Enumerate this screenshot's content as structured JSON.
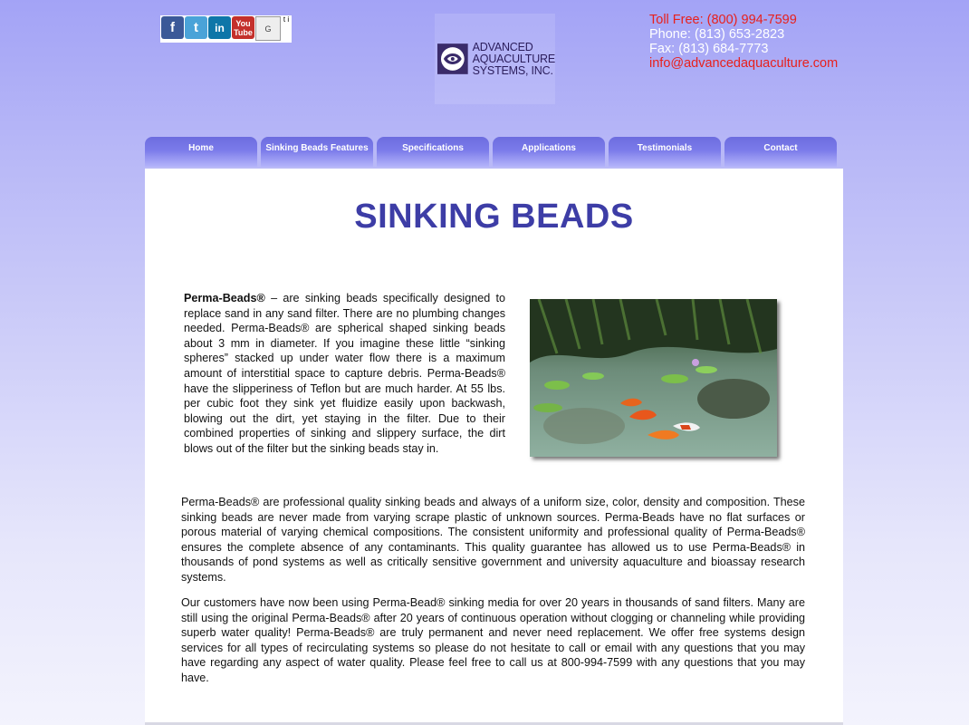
{
  "social": {
    "facebook": "f",
    "twitter": "t",
    "linkedin": "in",
    "youtube_1": "You",
    "youtube_2": "Tube",
    "google_alt": "G",
    "extra_alt": "t i"
  },
  "logo": {
    "line1": "ADVANCED",
    "line2": "AQUACULTURE",
    "line3": "SYSTEMS, INC."
  },
  "contact": {
    "toll_free": "Toll Free: (800) 994-7599",
    "phone": "Phone: (813) 653-2823",
    "fax": "Fax: (813) 684-7773",
    "email": "info@advancedaquaculture.com"
  },
  "nav": {
    "items": [
      "Home",
      "Sinking Beads Features",
      "Specifications",
      "Applications",
      "Testimonials",
      "Contact"
    ]
  },
  "page": {
    "title": "SINKING BEADS",
    "intro_bold": "Perma-Beads®",
    "intro_text": " – are sinking beads specifically designed to replace sand in any sand filter. There are no plumbing changes needed. Perma-Beads® are spherical shaped sinking beads about 3 mm in diameter. If you imagine these little “sinking spheres” stacked up under water flow there is a maximum amount of interstitial space to capture debris. Perma-Beads® have the slipperiness of Teflon but are much harder. At 55 lbs. per cubic foot they sink yet fluidize easily upon backwash, blowing out the dirt, yet staying in the filter. Due to their combined properties of sinking and slippery surface, the dirt blows out of the filter but the sinking beads stay in.",
    "para2": "Perma-Beads® are professional quality sinking beads and always of a uniform size, color, density and composition. These sinking beads are never made from varying scrape plastic of unknown sources. Perma-Beads have no flat surfaces or porous material of varying chemical compositions. The consistent uniformity and professional quality of Perma-Beads® ensures the complete absence of any contaminants. This quality guarantee has allowed us to use Perma-Beads® in thousands of pond systems as well as critically sensitive government and university aquaculture and bioassay research systems.",
    "para3": "Our customers have now been using Perma-Bead® sinking media for over 20 years in thousands of sand filters. Many are still using the original Perma-Beads® after 20 years of continuous operation without clogging or channeling while providing superb water quality! Perma-Beads® are truly permanent and never need replacement. We offer free systems design services for all types of recirculating systems so please do not hesitate to call or email with any questions that you may have regarding any aspect of water quality. Please feel free to call us at 800-994-7599 with any questions that you may have."
  }
}
